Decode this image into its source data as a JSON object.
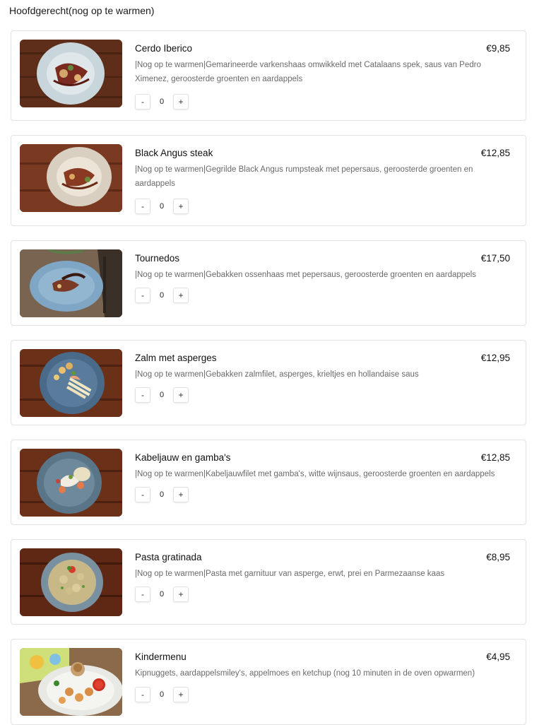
{
  "section": {
    "title": "Hoofdgerecht(nog op te warmen)"
  },
  "items": [
    {
      "name": "Cerdo Iberico",
      "price": "€9,85",
      "description": "|Nog op te warmen|Gemarineerde varkenshaas omwikkeld met Catalaans spek, saus van Pedro Ximenez, geroosterde groenten en aardappels",
      "quantity": "0",
      "minus": "-",
      "plus": "+",
      "image": "plated-pork-dish"
    },
    {
      "name": "Black Angus steak",
      "price": "€12,85",
      "description": "|Nog op te warmen|Gegrilde Black Angus rumpsteak met pepersaus, geroosterde groenten en aardappels",
      "quantity": "0",
      "minus": "-",
      "plus": "+",
      "image": "plated-steak-dish"
    },
    {
      "name": "Tournedos",
      "price": "€17,50",
      "description": "|Nog op te warmen|Gebakken ossenhaas met pepersaus, geroosterde groenten en aardappels",
      "quantity": "0",
      "minus": "-",
      "plus": "+",
      "image": "plated-tournedos-dish"
    },
    {
      "name": "Zalm met asperges",
      "price": "€12,95",
      "description": "|Nog op te warmen|Gebakken zalmfilet, asperges, krieltjes en hollandaise saus",
      "quantity": "0",
      "minus": "-",
      "plus": "+",
      "image": "plated-salmon-dish"
    },
    {
      "name": "Kabeljauw en gamba's",
      "price": "€12,85",
      "description": "|Nog op te warmen|Kabeljauwfilet met gamba's, witte wijnsaus, geroosterde groenten en aardappels",
      "quantity": "0",
      "minus": "-",
      "plus": "+",
      "image": "plated-cod-dish"
    },
    {
      "name": "Pasta gratinada",
      "price": "€8,95",
      "description": "|Nog op te warmen|Pasta met garnituur van asperge, erwt, prei en Parmezaanse kaas",
      "quantity": "0",
      "minus": "-",
      "plus": "+",
      "image": "plated-pasta-dish"
    },
    {
      "name": "Kindermenu",
      "price": "€4,95",
      "description": "Kipnuggets, aardappelsmiley's, appelmoes en ketchup (nog 10 minuten in de oven opwarmen)",
      "quantity": "0",
      "minus": "-",
      "plus": "+",
      "image": "kids-menu-plate"
    }
  ],
  "colors": {
    "card_border": "#e3e3e3",
    "description_text": "#6a6a6a",
    "wood": "#6b3420",
    "plate_blue": "#7fa6c4"
  }
}
